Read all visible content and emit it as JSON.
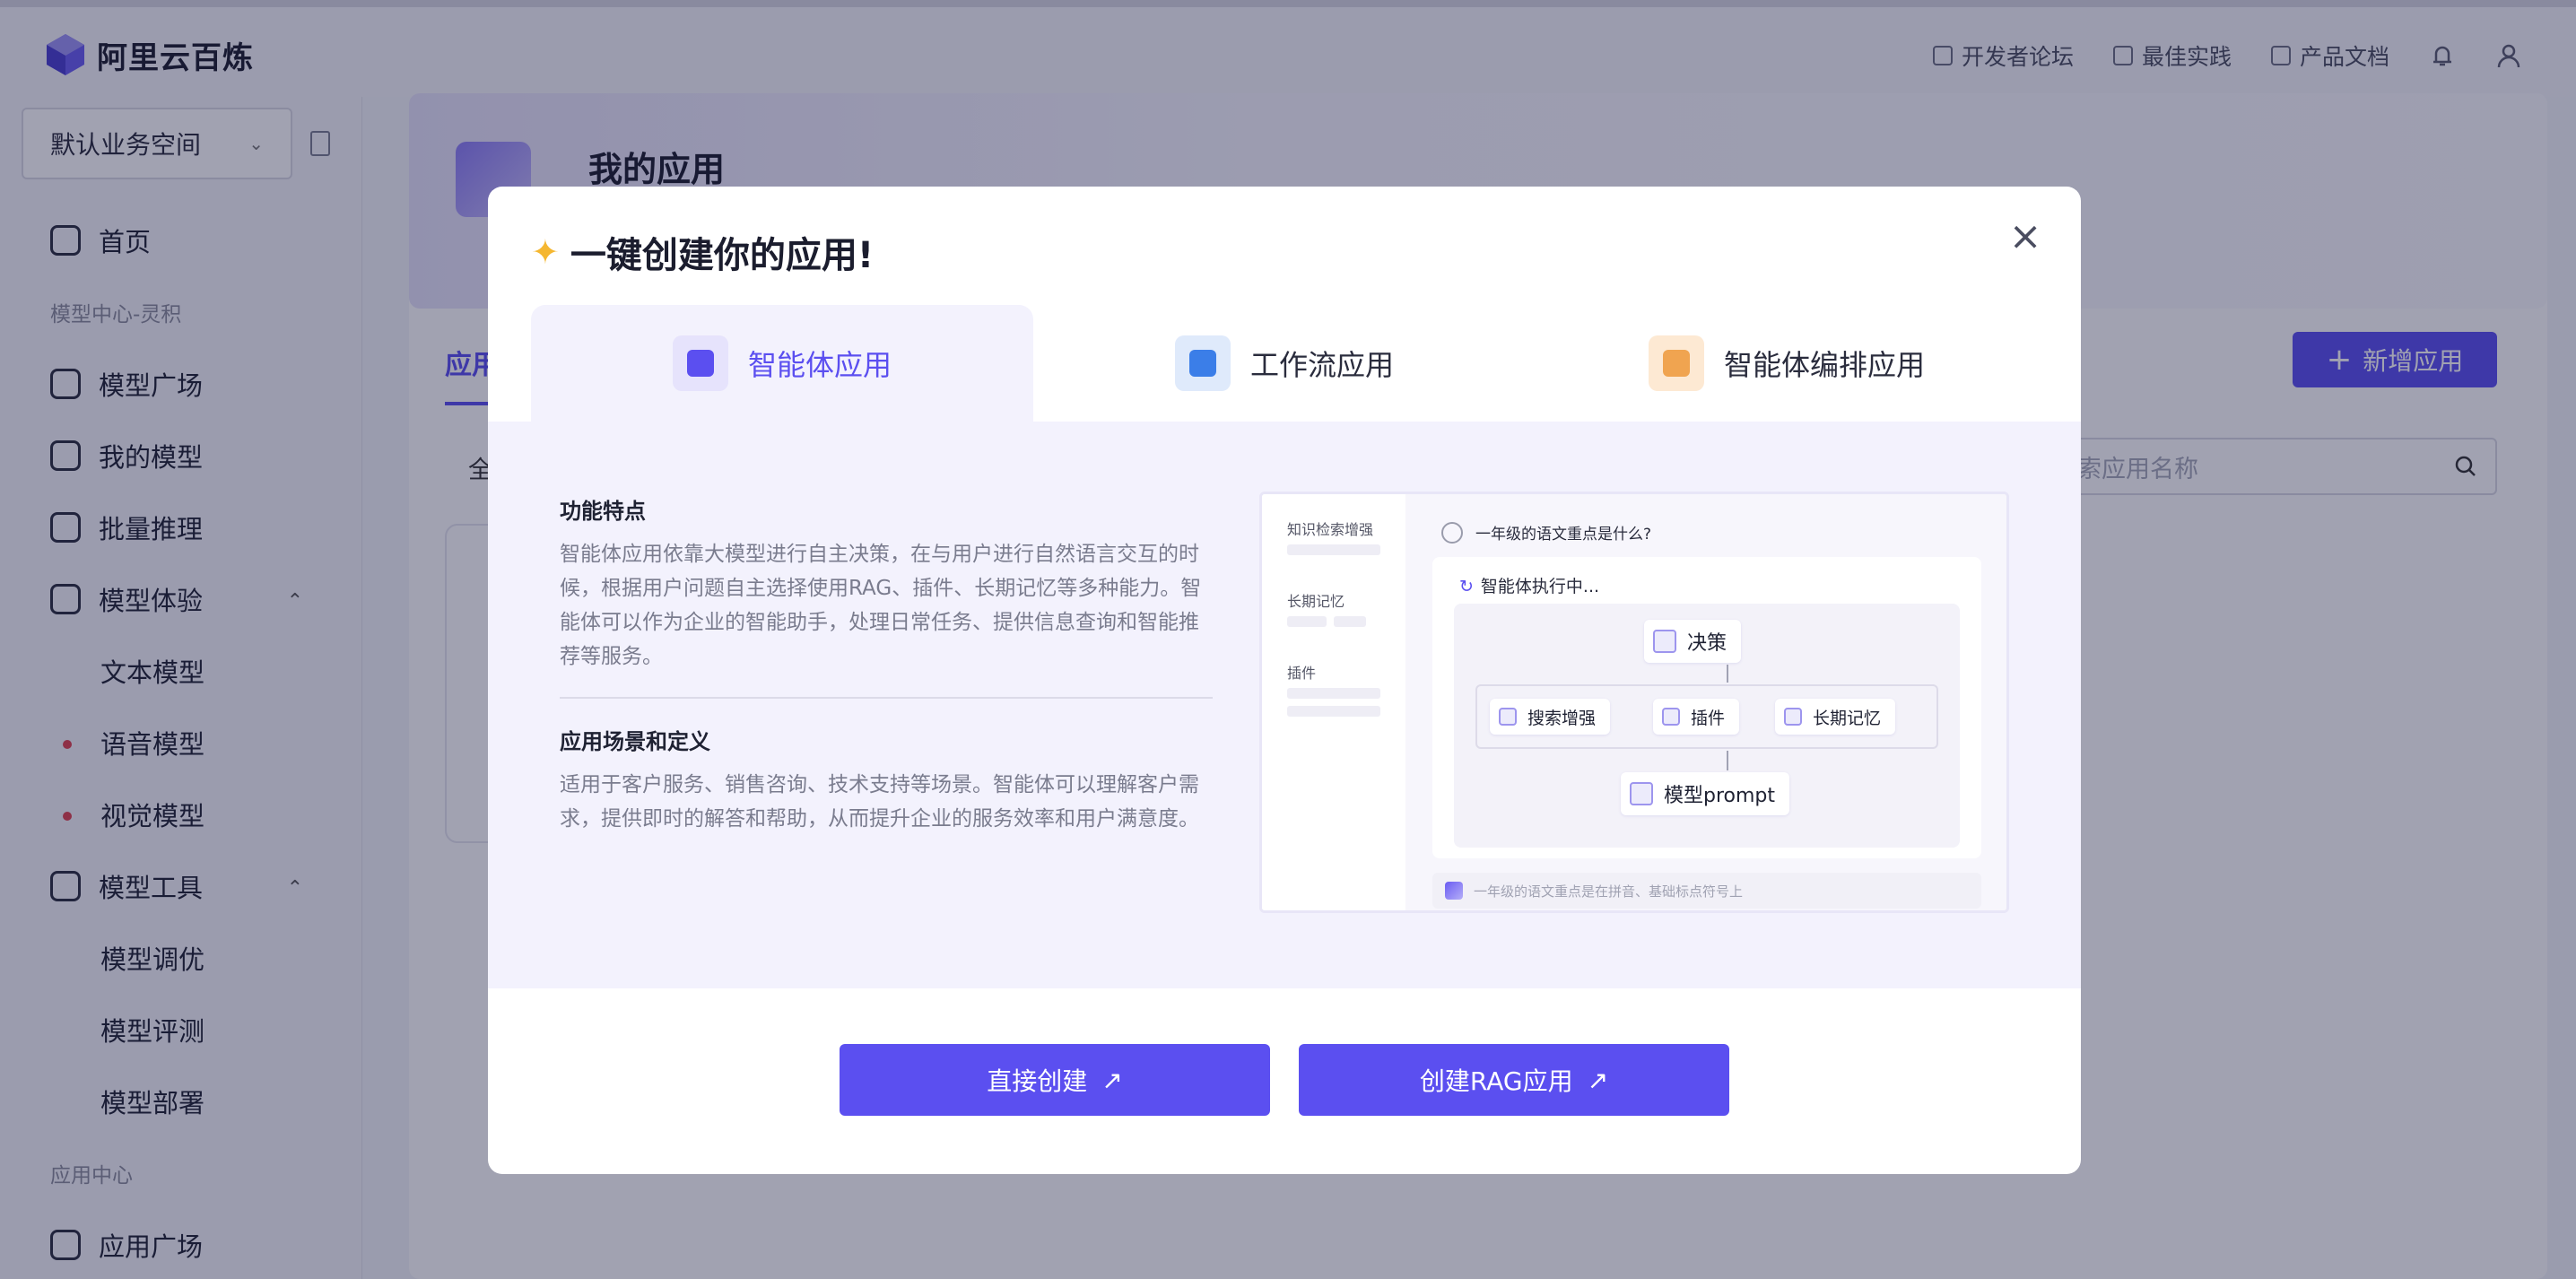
{
  "brand": {
    "name": "阿里云百炼"
  },
  "top_links": [
    {
      "label": "开发者论坛",
      "icon": "forum-icon"
    },
    {
      "label": "最佳实践",
      "icon": "practice-icon"
    },
    {
      "label": "产品文档",
      "icon": "document-icon"
    }
  ],
  "workspace": {
    "value": "默认业务空间"
  },
  "sidebar": {
    "home": "首页",
    "section_model": "模型中心-灵积",
    "items": [
      {
        "label": "模型广场"
      },
      {
        "label": "我的模型"
      },
      {
        "label": "批量推理"
      },
      {
        "label": "模型体验"
      },
      {
        "label": "文本模型"
      },
      {
        "label": "语音模型"
      },
      {
        "label": "视觉模型"
      },
      {
        "label": "模型工具"
      },
      {
        "label": "模型调优"
      },
      {
        "label": "模型评测"
      },
      {
        "label": "模型部署"
      }
    ],
    "section_app": "应用中心",
    "app_plaza": "应用广场"
  },
  "page": {
    "title": "我的应用",
    "tab_peek": "应用",
    "all_peek": "全",
    "new_app": "新增应用",
    "search_placeholder": "索应用名称"
  },
  "modal": {
    "title": "一键创建你的应用!",
    "tabs": [
      {
        "label": "智能体应用",
        "color": "#5b4ff0"
      },
      {
        "label": "工作流应用",
        "color": "#3b7ee8"
      },
      {
        "label": "智能体编排应用",
        "color": "#f08c2e"
      }
    ],
    "features_heading": "功能特点",
    "features_text": "智能体应用依靠大模型进行自主决策，在与用户进行自然语言交互的时候，根据用户问题自主选择使用RAG、插件、长期记忆等多种能力。智能体可以作为企业的智能助手，处理日常任务、提供信息查询和智能推荐等服务。",
    "scenario_heading": "应用场景和定义",
    "scenario_text": "适用于客户服务、销售咨询、技术支持等场景。智能体可以理解客户需求，提供即时的解答和帮助，从而提升企业的服务效率和用户满意度。",
    "illustration": {
      "side_labels": [
        "知识检索增强",
        "长期记忆",
        "插件"
      ],
      "question": "一年级的语文重点是什么?",
      "running": "智能体执行中...",
      "nodes": {
        "decision": "决策",
        "rag": "搜索增强",
        "plugin": "插件",
        "memory": "长期记忆",
        "prompt": "模型prompt"
      },
      "answer": "一年级的语文重点是在拼音、基础标点符号上"
    },
    "buttons": {
      "direct": "直接创建",
      "rag": "创建RAG应用"
    }
  },
  "colors": {
    "accent": "#5b4ff0",
    "overlay": "rgba(20,22,60,0.40)"
  }
}
